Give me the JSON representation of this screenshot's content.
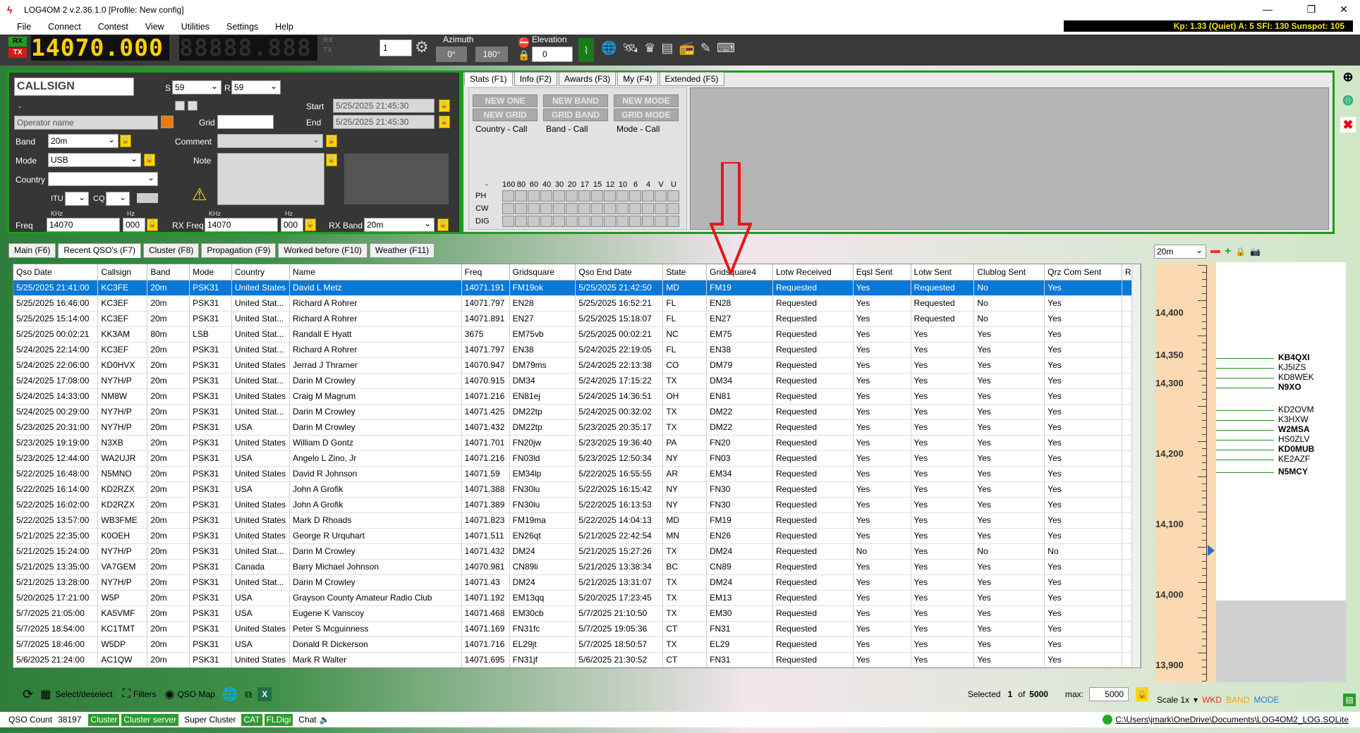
{
  "window": {
    "title": "LOG4OM 2 v.2.36.1.0 [Profile: New config]"
  },
  "menu": [
    "File",
    "Connect",
    "Contest",
    "View",
    "Utilities",
    "Settings",
    "Help"
  ],
  "solar": {
    "text": "Kp: 1.33 (Quiet)  A: 5  SFI: 130  Sunspot: 105"
  },
  "vfo": {
    "rx_label": "RX",
    "tx_label": "TX",
    "frequency": "14070.000",
    "frequency2": "88888.888",
    "small_rx": "RX",
    "small_tx": "TX",
    "spin_value": "1",
    "azimuth_label": "Azimuth",
    "az1": "0°",
    "az2": "180°",
    "elevation_label": "Elevation",
    "elevation_value": "0"
  },
  "entry": {
    "callsign": "CALLSIGN",
    "s_label": "S",
    "s_value": "59",
    "r_label": "R",
    "r_value": "59",
    "dash": "-",
    "operator_placeholder": "Operator name",
    "grid_label": "Grid",
    "start_label": "Start",
    "start_value": "5/25/2025 21:45:30",
    "end_label": "End",
    "end_value": "5/25/2025 21:45:30",
    "band_label": "Band",
    "band_value": "20m",
    "mode_label": "Mode",
    "mode_value": "USB",
    "country_label": "Country",
    "comment_label": "Comment",
    "note_label": "Note",
    "itu_label": "ITU",
    "cq_label": "CQ",
    "khz_label": "KHz",
    "hz_label": "Hz",
    "freq_label": "Freq",
    "freq_khz": "14070",
    "freq_hz": "000",
    "rxfreq_label": "RX Freq",
    "rxfreq_khz": "14070",
    "rxfreq_hz": "000",
    "rxband_label": "RX Band",
    "rxband_value": "20m"
  },
  "stats": {
    "tabs": [
      "Stats (F1)",
      "Info (F2)",
      "Awards (F3)",
      "My (F4)",
      "Extended (F5)"
    ],
    "buttons": [
      [
        "NEW ONE",
        "NEW GRID",
        "Country - Call"
      ],
      [
        "NEW BAND",
        "GRID BAND",
        "Band - Call"
      ],
      [
        "NEW MODE",
        "GRID MODE",
        "Mode - Call"
      ]
    ],
    "grid_header": [
      "-",
      "160",
      "80",
      "60",
      "40",
      "30",
      "20",
      "17",
      "15",
      "12",
      "10",
      "6",
      "4",
      "V",
      "U"
    ],
    "grid_rows": [
      "PH",
      "CW",
      "DIG"
    ]
  },
  "lower_tabs": [
    "Main (F6)",
    "Recent QSO's (F7)",
    "Cluster (F8)",
    "Propagation (F9)",
    "Worked before (F10)",
    "Weather (F11)"
  ],
  "table": {
    "columns": [
      "Qso Date",
      "Callsign",
      "Band",
      "Mode",
      "Country",
      "Name",
      "Freq",
      "Gridsquare",
      "Qso End Date",
      "State",
      "Gridsquare4",
      "Lotw Received",
      "Eqsl Sent",
      "Lotw Sent",
      "Clublog Sent",
      "Qrz Com Sent",
      "R"
    ],
    "rows": [
      [
        "5/25/2025 21:41:00",
        "KC3FE",
        "20m",
        "PSK31",
        "United States",
        "David L Metz",
        "14071.191",
        "FM19ok",
        "5/25/2025 21:42:50",
        "MD",
        "FM19",
        "Requested",
        "Yes",
        "Requested",
        "No",
        "Yes"
      ],
      [
        "5/25/2025 16:46:00",
        "KC3EF",
        "20m",
        "PSK31",
        "United Stat...",
        "Richard A Rohrer",
        "14071.797",
        "EN28",
        "5/25/2025 16:52:21",
        "FL",
        "EN28",
        "Requested",
        "Yes",
        "Requested",
        "No",
        "Yes"
      ],
      [
        "5/25/2025 15:14:00",
        "KC3EF",
        "20m",
        "PSK31",
        "United Stat...",
        "Richard A Rohrer",
        "14071.891",
        "EN27",
        "5/25/2025 15:18:07",
        "FL",
        "EN27",
        "Requested",
        "Yes",
        "Requested",
        "No",
        "Yes"
      ],
      [
        "5/25/2025 00:02:21",
        "KK3AM",
        "80m",
        "LSB",
        "United Stat...",
        "Randall E Hyatt",
        "3675",
        "EM75vb",
        "5/25/2025 00:02:21",
        "NC",
        "EM75",
        "Requested",
        "Yes",
        "Yes",
        "Yes",
        "Yes"
      ],
      [
        "5/24/2025 22:14:00",
        "KC3EF",
        "20m",
        "PSK31",
        "United Stat...",
        "Richard A Rohrer",
        "14071.797",
        "EN38",
        "5/24/2025 22:19:05",
        "FL",
        "EN38",
        "Requested",
        "Yes",
        "Yes",
        "Yes",
        "Yes"
      ],
      [
        "5/24/2025 22:06:00",
        "KD0HVX",
        "20m",
        "PSK31",
        "United States",
        "Jerrad J Thramer",
        "14070.947",
        "DM79ms",
        "5/24/2025 22:13:38",
        "CO",
        "DM79",
        "Requested",
        "Yes",
        "Yes",
        "Yes",
        "Yes"
      ],
      [
        "5/24/2025 17:08:00",
        "NY7H/P",
        "20m",
        "PSK31",
        "United Stat...",
        "Darin M Crowley",
        "14070.915",
        "DM34",
        "5/24/2025 17:15:22",
        "TX",
        "DM34",
        "Requested",
        "Yes",
        "Yes",
        "Yes",
        "Yes"
      ],
      [
        "5/24/2025 14:33:00",
        "NM8W",
        "20m",
        "PSK31",
        "United States",
        "Craig M Magrum",
        "14071.216",
        "EN81ej",
        "5/24/2025 14:36:51",
        "OH",
        "EN81",
        "Requested",
        "Yes",
        "Yes",
        "Yes",
        "Yes"
      ],
      [
        "5/24/2025 00:29:00",
        "NY7H/P",
        "20m",
        "PSK31",
        "United Stat...",
        "Darin M Crowley",
        "14071.425",
        "DM22tp",
        "5/24/2025 00:32:02",
        "TX",
        "DM22",
        "Requested",
        "Yes",
        "Yes",
        "Yes",
        "Yes"
      ],
      [
        "5/23/2025 20:31:00",
        "NY7H/P",
        "20m",
        "PSK31",
        "USA",
        "Darin M Crowley",
        "14071.432",
        "DM22tp",
        "5/23/2025 20:35:17",
        "TX",
        "DM22",
        "Requested",
        "Yes",
        "Yes",
        "Yes",
        "Yes"
      ],
      [
        "5/23/2025 19:19:00",
        "N3XB",
        "20m",
        "PSK31",
        "United States",
        "William D Gontz",
        "14071.701",
        "FN20jw",
        "5/23/2025 19:36:40",
        "PA",
        "FN20",
        "Requested",
        "Yes",
        "Yes",
        "Yes",
        "Yes"
      ],
      [
        "5/23/2025 12:44:00",
        "WA2UJR",
        "20m",
        "PSK31",
        "USA",
        "Angelo L Zino, Jr",
        "14071.216",
        "FN03ld",
        "5/23/2025 12:50:34",
        "NY",
        "FN03",
        "Requested",
        "Yes",
        "Yes",
        "Yes",
        "Yes"
      ],
      [
        "5/22/2025 16:48:00",
        "N5MNO",
        "20m",
        "PSK31",
        "United States",
        "David R Johnson",
        "14071.59",
        "EM34lp",
        "5/22/2025 16:55:55",
        "AR",
        "EM34",
        "Requested",
        "Yes",
        "Yes",
        "Yes",
        "Yes"
      ],
      [
        "5/22/2025 16:14:00",
        "KD2RZX",
        "20m",
        "PSK31",
        "USA",
        "John A Grofik",
        "14071.388",
        "FN30lu",
        "5/22/2025 16:15:42",
        "NY",
        "FN30",
        "Requested",
        "Yes",
        "Yes",
        "Yes",
        "Yes"
      ],
      [
        "5/22/2025 16:02:00",
        "KD2RZX",
        "20m",
        "PSK31",
        "United States",
        "John A Grofik",
        "14071.389",
        "FN30lu",
        "5/22/2025 16:13:53",
        "NY",
        "FN30",
        "Requested",
        "Yes",
        "Yes",
        "Yes",
        "Yes"
      ],
      [
        "5/22/2025 13:57:00",
        "WB3FME",
        "20m",
        "PSK31",
        "United States",
        "Mark D Rhoads",
        "14071.823",
        "FM19ma",
        "5/22/2025 14:04:13",
        "MD",
        "FM19",
        "Requested",
        "Yes",
        "Yes",
        "Yes",
        "Yes"
      ],
      [
        "5/21/2025 22:35:00",
        "K0OEH",
        "20m",
        "PSK31",
        "United States",
        "George R Urquhart",
        "14071.511",
        "EN26qt",
        "5/21/2025 22:42:54",
        "MN",
        "EN26",
        "Requested",
        "Yes",
        "Yes",
        "Yes",
        "Yes"
      ],
      [
        "5/21/2025 15:24:00",
        "NY7H/P",
        "20m",
        "PSK31",
        "United Stat...",
        "Darin M Crowley",
        "14071.432",
        "DM24",
        "5/21/2025 15:27:26",
        "TX",
        "DM24",
        "Requested",
        "No",
        "Yes",
        "No",
        "No"
      ],
      [
        "5/21/2025 13:35:00",
        "VA7GEM",
        "20m",
        "PSK31",
        "Canada",
        "Barry Michael Johnson",
        "14070.981",
        "CN89li",
        "5/21/2025 13:38:34",
        "BC",
        "CN89",
        "Requested",
        "Yes",
        "Yes",
        "Yes",
        "Yes"
      ],
      [
        "5/21/2025 13:28:00",
        "NY7H/P",
        "20m",
        "PSK31",
        "United Stat...",
        "Darin M Crowley",
        "14071.43",
        "DM24",
        "5/21/2025 13:31:07",
        "TX",
        "DM24",
        "Requested",
        "Yes",
        "Yes",
        "Yes",
        "Yes"
      ],
      [
        "5/20/2025 17:21:00",
        "W5P",
        "20m",
        "PSK31",
        "USA",
        "Grayson County Amateur Radio Club",
        "14071.192",
        "EM13qq",
        "5/20/2025 17:23:45",
        "TX",
        "EM13",
        "Requested",
        "Yes",
        "Yes",
        "Yes",
        "Yes"
      ],
      [
        "5/7/2025 21:05:00",
        "KA5VMF",
        "20m",
        "PSK31",
        "USA",
        "Eugene K Vanscoy",
        "14071.468",
        "EM30cb",
        "5/7/2025 21:10:50",
        "TX",
        "EM30",
        "Requested",
        "Yes",
        "Yes",
        "Yes",
        "Yes"
      ],
      [
        "5/7/2025 18:54:00",
        "KC1TMT",
        "20m",
        "PSK31",
        "United States",
        "Peter S Mcguinness",
        "14071.169",
        "FN31fc",
        "5/7/2025 19:05:36",
        "CT",
        "FN31",
        "Requested",
        "Yes",
        "Yes",
        "Yes",
        "Yes"
      ],
      [
        "5/7/2025 18:46:00",
        "W5DP",
        "20m",
        "PSK31",
        "USA",
        "Donald R Dickerson",
        "14071.716",
        "EL29jt",
        "5/7/2025 18:50:57",
        "TX",
        "EL29",
        "Requested",
        "Yes",
        "Yes",
        "Yes",
        "Yes"
      ],
      [
        "5/6/2025 21:24:00",
        "AC1QW",
        "20m",
        "PSK31",
        "United States",
        "Mark R Walter",
        "14071.695",
        "FN31jf",
        "5/6/2025 21:30:52",
        "CT",
        "FN31",
        "Requested",
        "Yes",
        "Yes",
        "Yes",
        "Yes"
      ]
    ]
  },
  "bottom": {
    "select_label": "Select/deselect",
    "filters_label": "Filters",
    "qsomap_label": "QSO Map",
    "selected_label": "Selected",
    "selected_value": "1",
    "of_label": "of",
    "total": "5000",
    "max_label": "max:",
    "max_value": "5000"
  },
  "bandmap": {
    "band_value": "20m",
    "ticks": [
      "14,400",
      "14,350",
      "14,300",
      "14,200",
      "14,100",
      "14,000",
      "13,900"
    ],
    "spots": [
      {
        "call": "KB4QXI",
        "bold": true
      },
      {
        "call": "KJ5IZS",
        "bold": false
      },
      {
        "call": "KD8WEK",
        "bold": false
      },
      {
        "call": "N9XO",
        "bold": true
      },
      {
        "call": "KD2OVM",
        "bold": false
      },
      {
        "call": "K3HXW",
        "bold": false
      },
      {
        "call": "W2MSA",
        "bold": true
      },
      {
        "call": "HS0ZLV",
        "bold": false
      },
      {
        "call": "KD0MUB",
        "bold": true
      },
      {
        "call": "KE2AZF",
        "bold": false
      },
      {
        "call": "N5MCY",
        "bold": true
      }
    ],
    "scale_label": "Scale 1x",
    "wkd": "WKD",
    "band": "BAND",
    "mode": "MODE",
    "colors": {
      "wkd": "#e0301e",
      "band": "#f0a020",
      "mode": "#2a7fd0"
    }
  },
  "status": {
    "qso_count_label": "QSO Count",
    "qso_count": "38197",
    "cluster": "Cluster",
    "cluster_server": "Cluster server",
    "super_cluster": "Super Cluster",
    "cat": "CAT",
    "fldigi": "FLDigi",
    "chat": "Chat",
    "db_path": "C:\\Users\\jmark\\OneDrive\\Documents\\LOG4OM2_LOG.SQLite"
  }
}
